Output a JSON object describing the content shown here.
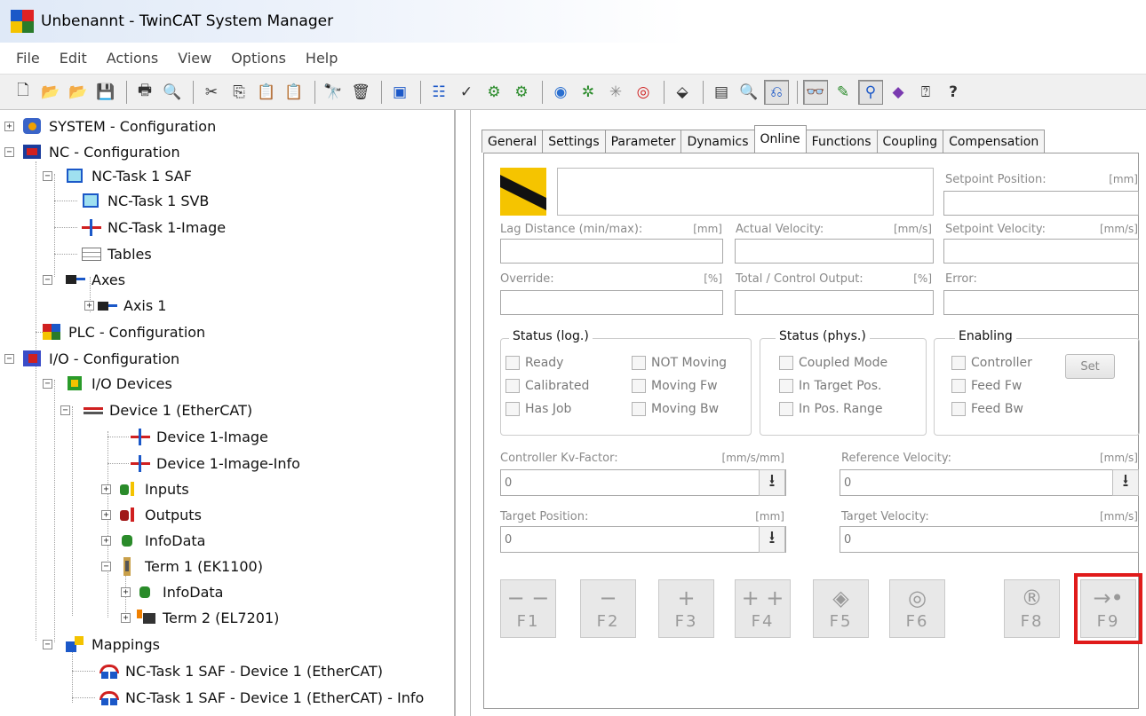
{
  "window": {
    "title": "Unbenannt - TwinCAT System Manager"
  },
  "menu": [
    "File",
    "Edit",
    "Actions",
    "View",
    "Options",
    "Help"
  ],
  "toolbar": {
    "icons": [
      "new-file",
      "open-file",
      "open-from-target",
      "save",
      "print",
      "print-preview",
      "cut",
      "copy",
      "paste",
      "paste-with-links",
      "find",
      "delete",
      "monitor",
      "activate-configuration",
      "check-configuration",
      "set-run-mode",
      "restart",
      "choose-target",
      "scan-devices",
      "toggle-freerun",
      "show-online-data",
      "edit-group",
      "zoom",
      "view-mappings",
      "show-online-graph",
      "ads-connect",
      "scope",
      "teach",
      "help",
      "context-help"
    ]
  },
  "tree": {
    "nodes": [
      {
        "label": "SYSTEM - Configuration",
        "icon": "system-icon"
      },
      {
        "label": "NC - Configuration",
        "icon": "nc-icon"
      },
      {
        "label": "NC-Task 1 SAF",
        "icon": "task-icon"
      },
      {
        "label": "NC-Task 1 SVB",
        "icon": "task-icon"
      },
      {
        "label": "NC-Task 1-Image",
        "icon": "image-icon"
      },
      {
        "label": "Tables",
        "icon": "table-icon"
      },
      {
        "label": "Axes",
        "icon": "axes-icon"
      },
      {
        "label": "Axis 1",
        "icon": "axis-icon"
      },
      {
        "label": "PLC - Configuration",
        "icon": "plc-icon"
      },
      {
        "label": "I/O - Configuration",
        "icon": "io-icon"
      },
      {
        "label": "I/O Devices",
        "icon": "io-devices-icon"
      },
      {
        "label": "Device 1 (EtherCAT)",
        "icon": "ethercat-device-icon"
      },
      {
        "label": "Device 1-Image",
        "icon": "image-icon"
      },
      {
        "label": "Device 1-Image-Info",
        "icon": "image-icon"
      },
      {
        "label": "Inputs",
        "icon": "inputs-icon"
      },
      {
        "label": "Outputs",
        "icon": "outputs-icon"
      },
      {
        "label": "InfoData",
        "icon": "infodata-icon"
      },
      {
        "label": "Term 1 (EK1100)",
        "icon": "terminal-icon"
      },
      {
        "label": "InfoData",
        "icon": "infodata-icon"
      },
      {
        "label": "Term 2 (EL7201)",
        "icon": "terminal-icon"
      },
      {
        "label": "Mappings",
        "icon": "mappings-icon"
      },
      {
        "label": "NC-Task 1 SAF - Device 1 (EtherCAT)",
        "icon": "mapping-icon"
      },
      {
        "label": "NC-Task 1 SAF - Device 1 (EtherCAT) - Info",
        "icon": "mapping-icon"
      }
    ]
  },
  "tabs": [
    "General",
    "Settings",
    "Parameter",
    "Dynamics",
    "Online",
    "Functions",
    "Coupling",
    "Compensation"
  ],
  "active_tab": "Online",
  "online": {
    "main_value": "",
    "setpoint_position": {
      "label": "Setpoint Position:",
      "unit": "[mm]",
      "value": ""
    },
    "lag_distance": {
      "label": "Lag Distance (min/max):",
      "unit": "[mm]",
      "value": ""
    },
    "actual_velocity": {
      "label": "Actual Velocity:",
      "unit": "[mm/s]",
      "value": ""
    },
    "setpoint_velocity": {
      "label": "Setpoint Velocity:",
      "unit": "[mm/s]",
      "value": ""
    },
    "override": {
      "label": "Override:",
      "unit": "[%]",
      "value": ""
    },
    "control_output": {
      "label": "Total / Control Output:",
      "unit": "[%]",
      "value": ""
    },
    "error": {
      "label": "Error:",
      "value": ""
    },
    "status_log": {
      "title": "Status (log.)",
      "items": [
        "Ready",
        "Calibrated",
        "Has Job",
        "NOT Moving",
        "Moving Fw",
        "Moving Bw"
      ]
    },
    "status_phys": {
      "title": "Status (phys.)",
      "items": [
        "Coupled Mode",
        "In Target Pos.",
        "In Pos. Range"
      ]
    },
    "enabling": {
      "title": "Enabling",
      "items": [
        "Controller",
        "Feed Fw",
        "Feed Bw"
      ],
      "set_label": "Set"
    },
    "kv_factor": {
      "label": "Controller Kv-Factor:",
      "unit": "[mm/s/mm]",
      "value": "0"
    },
    "reference_velocity": {
      "label": "Reference Velocity:",
      "unit": "[mm/s]",
      "value": "0"
    },
    "target_position": {
      "label": "Target Position:",
      "unit": "[mm]",
      "value": "0"
    },
    "target_velocity": {
      "label": "Target Velocity:",
      "unit": "[mm/s]",
      "value": "0"
    },
    "fkeys": [
      {
        "key": "F1",
        "symbol": "− −"
      },
      {
        "key": "F2",
        "symbol": "−"
      },
      {
        "key": "F3",
        "symbol": "+"
      },
      {
        "key": "F4",
        "symbol": "+ +"
      },
      {
        "key": "F5",
        "symbol": "◈"
      },
      {
        "key": "F6",
        "symbol": "◎"
      },
      {
        "key": "F8",
        "symbol": "®"
      },
      {
        "key": "F9",
        "symbol": "→•"
      }
    ]
  },
  "colors": {
    "highlight": "#e01b1b",
    "stripe_yellow": "#f5c400"
  }
}
